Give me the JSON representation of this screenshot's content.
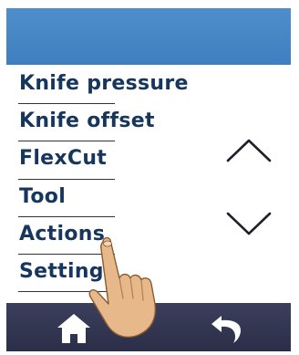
{
  "menu": {
    "items": [
      {
        "label": "Knife pressure"
      },
      {
        "label": "Knife offset"
      },
      {
        "label": "FlexCut"
      },
      {
        "label": "Tool"
      },
      {
        "label": "Actions"
      },
      {
        "label": "Settings"
      }
    ]
  },
  "icons": {
    "scroll_up": "chevron-up-icon",
    "scroll_down": "chevron-down-icon",
    "home": "home-icon",
    "back": "back-arrow-icon",
    "pointer": "pointing-hand-icon"
  },
  "colors": {
    "header": "#4a89c8",
    "footer": "#2f3350",
    "menu_text": "#17365d",
    "skin": "#e7b88a"
  }
}
